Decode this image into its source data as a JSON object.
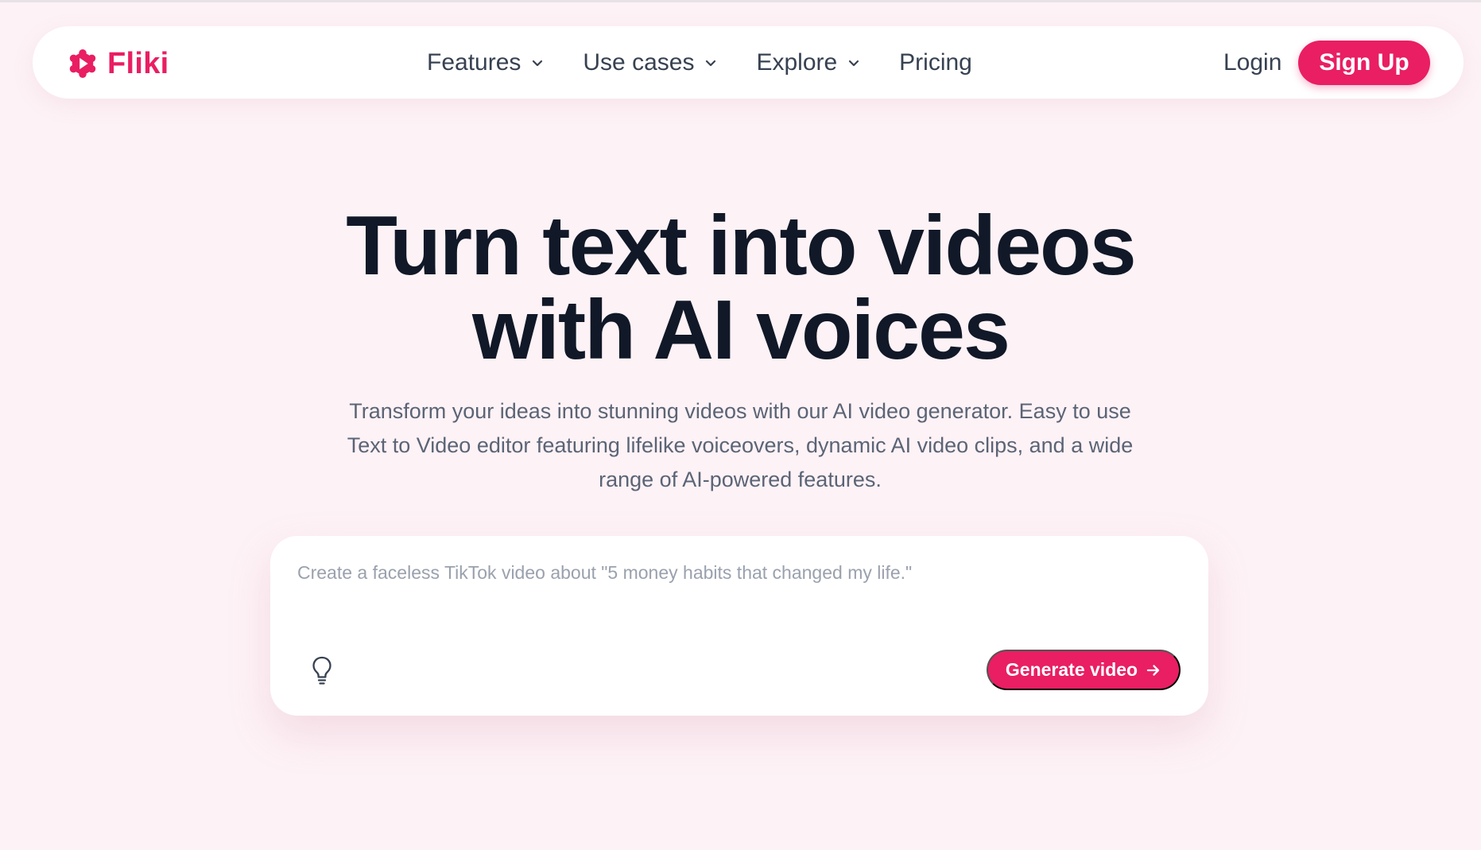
{
  "nav": {
    "brand": "Fliki",
    "menu": [
      {
        "label": "Features",
        "has_dropdown": true
      },
      {
        "label": "Use cases",
        "has_dropdown": true
      },
      {
        "label": "Explore",
        "has_dropdown": true
      },
      {
        "label": "Pricing",
        "has_dropdown": false
      }
    ],
    "login": "Login",
    "signup": "Sign Up"
  },
  "hero": {
    "title_line1": "Turn text into videos",
    "title_line2": "with AI voices",
    "subtitle": "Transform your ideas into stunning videos with our AI video generator. Easy to use Text to Video editor featuring lifelike voiceovers, dynamic AI video clips, and a wide range of AI-powered features."
  },
  "prompt": {
    "placeholder": "Create a faceless TikTok video about \"5 money habits that changed my life.\"",
    "value": "",
    "idea_icon": "lightbulb-icon",
    "generate_label": "Generate video"
  },
  "colors": {
    "accent": "#e91e63",
    "background": "#fdf2f6",
    "heading": "#111827",
    "body_text": "#5b6475"
  }
}
